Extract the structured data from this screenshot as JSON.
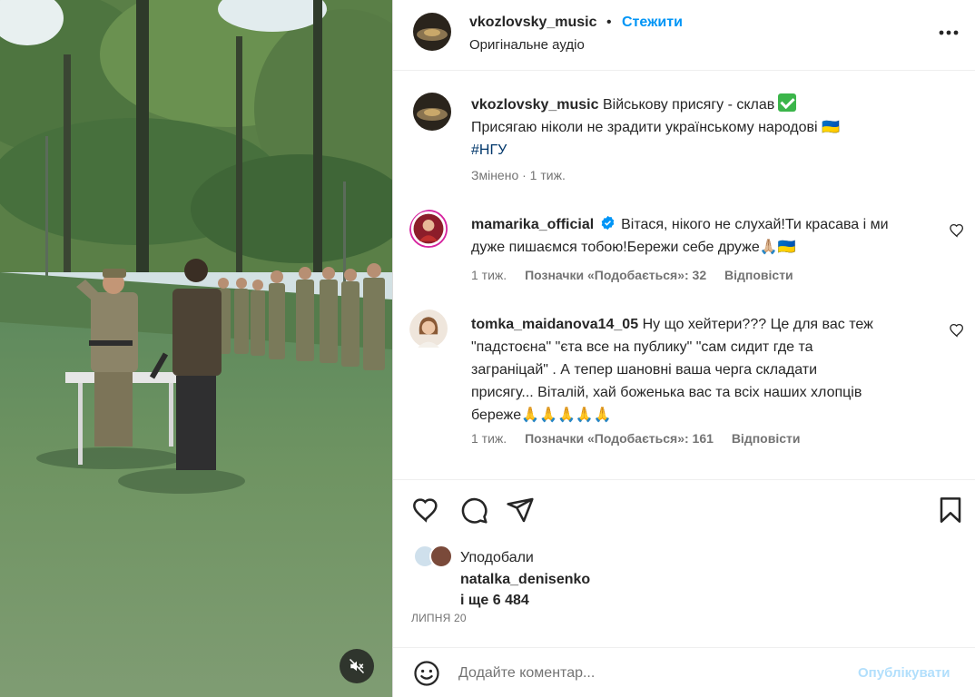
{
  "post": {
    "author": "vkozlovsky_music",
    "follow_label": "Стежити",
    "dot": "•",
    "audio_label": "Оригінальне аудіо",
    "caption_text": "Військову присягу - склав",
    "caption_line2": "Присягаю ніколи не зрадити українському народові 🇺🇦",
    "hashtag": "#НГУ",
    "edited_label": "Змінено · 1 тиж."
  },
  "comments": [
    {
      "user": "mamarika_official",
      "verified": true,
      "text_line1": "Вітася, нікого не слухай!Ти красава і ми",
      "text_line2": "дуже пишаємся тобою!Бережи себе друже🙏🏼🇺🇦",
      "age": "1 тиж.",
      "likes": "Позначки «Подобається»: 32",
      "reply": "Відповісти"
    },
    {
      "user": "tomka_maidanova14_05",
      "verified": false,
      "text_line1": "Ну що хейтери??? Це для вас теж",
      "text_line2": "\"падстоєна\" \"єта все на публику\" \"сам сидит где та",
      "text_line3": "заграніцай\" . А тепер шановні ваша черга складати",
      "text_line4": "присягу... Віталій, хай боженька вас та всіх наших хлопців",
      "text_line5": "береже🙏🙏🙏🙏🙏",
      "age": "1 тиж.",
      "likes": "Позначки «Подобається»: 161",
      "reply": "Відповісти"
    }
  ],
  "likes": {
    "label": "Уподобали",
    "user": "natalka_denisenko",
    "and_more": "і ще 6 484"
  },
  "date": "ЛИПНЯ 20",
  "add_comment": {
    "placeholder": "Додайте коментар...",
    "publish_label": "Опублікувати"
  },
  "icons": {
    "more": "more-horizontal-icon",
    "like": "heart-icon",
    "comment": "comment-bubble-icon",
    "share": "paper-plane-icon",
    "save": "bookmark-icon",
    "emoji": "emoji-smile-icon",
    "mute": "speaker-muted-icon",
    "comment_like": "heart-small-icon",
    "verified": "verified-badge-icon"
  },
  "colors": {
    "accent": "#0095f6",
    "verified": "#0095f6",
    "publish_disabled": "#b2dffc",
    "muted_text": "#737373"
  }
}
